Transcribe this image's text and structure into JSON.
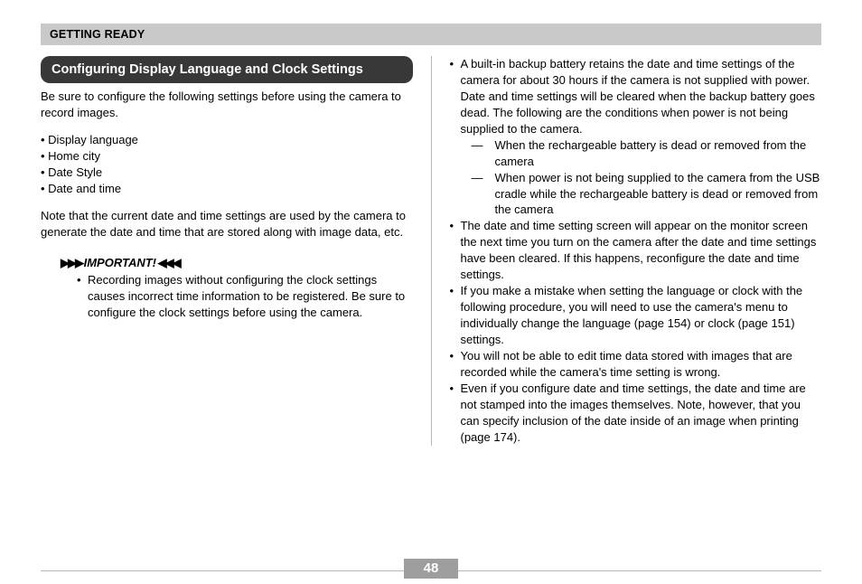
{
  "header": {
    "breadcrumb": "GETTING READY"
  },
  "section": {
    "title": "Configuring Display Language and Clock Settings"
  },
  "left": {
    "intro": "Be sure to configure the following settings before using the camera to record images.",
    "bullets": [
      "Display language",
      "Home city",
      "Date Style",
      "Date and time"
    ],
    "note": "Note that the current date and time settings are used by the camera to generate the date and time that are stored along with image data, etc.",
    "important_label": "IMPORTANT!",
    "important": [
      "Recording images without configuring the clock settings causes incorrect time information to be registered. Be sure to configure the clock settings before using the camera."
    ]
  },
  "right": {
    "items": [
      {
        "text": "A built-in backup battery retains the date and time settings of the camera for about 30 hours if the camera is not supplied with power. Date and time settings will be cleared when the backup battery goes dead. The following are the conditions when power is not being supplied to the camera.",
        "sub": [
          "When the rechargeable battery is dead or removed from the camera",
          "When power is not being supplied to the camera from the USB cradle while the rechargeable battery is dead or removed from the camera"
        ]
      },
      {
        "text": "The date and time setting screen will appear on the monitor screen the next time you turn on the camera after the date and time settings have been cleared. If this happens, reconfigure the date and time settings."
      },
      {
        "text": "If you make a mistake when setting the language or clock with the following procedure, you will need to use the camera's menu to individually change the language (page 154) or clock (page 151) settings."
      },
      {
        "text": "You will not be able to edit time data stored with images that are recorded while the camera's time setting is wrong."
      },
      {
        "text": "Even if you configure date and time settings, the date and time are not stamped into the images themselves. Note, however, that you can specify inclusion of the date inside of an image when printing (page 174)."
      }
    ]
  },
  "page_number": "48"
}
